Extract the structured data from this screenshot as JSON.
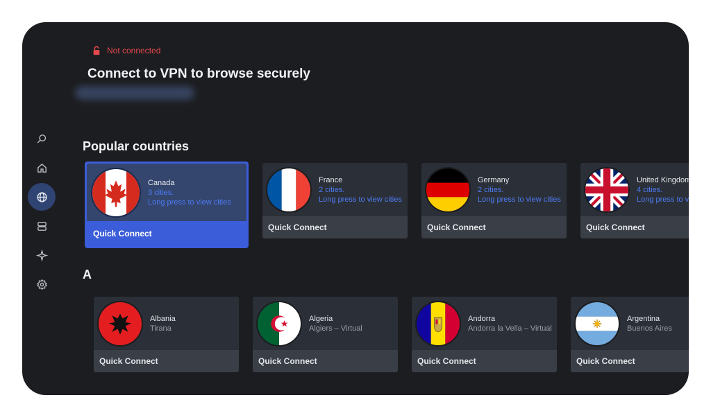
{
  "status": {
    "label": "Not connected",
    "color": "#e5484d"
  },
  "header": {
    "title": "Connect to VPN to browse securely"
  },
  "sidebar": {
    "items": [
      {
        "name": "search",
        "icon": "search-icon"
      },
      {
        "name": "home",
        "icon": "home-icon"
      },
      {
        "name": "countries",
        "icon": "globe-icon",
        "active": true
      },
      {
        "name": "servers",
        "icon": "servers-icon"
      },
      {
        "name": "specialty",
        "icon": "star-icon"
      },
      {
        "name": "settings",
        "icon": "gear-icon"
      }
    ]
  },
  "popular": {
    "title": "Popular countries",
    "countries": [
      {
        "name": "Canada",
        "cities": "3 cities.",
        "hint": "Long press to view cities",
        "action": "Quick Connect",
        "selected": true
      },
      {
        "name": "France",
        "cities": "2 cities.",
        "hint": "Long press to view cities",
        "action": "Quick Connect"
      },
      {
        "name": "Germany",
        "cities": "2 cities.",
        "hint": "Long press to view cities",
        "action": "Quick Connect"
      },
      {
        "name": "United Kingdom",
        "cities": "4 cities.",
        "hint": "Long press to view cities",
        "action": "Quick Connect"
      }
    ]
  },
  "section_a": {
    "letter": "A",
    "countries": [
      {
        "name": "Albania",
        "sub": "Tirana",
        "action": "Quick Connect"
      },
      {
        "name": "Algeria",
        "sub": "Algiers – Virtual",
        "action": "Quick Connect"
      },
      {
        "name": "Andorra",
        "sub": "Andorra la Vella – Virtual",
        "action": "Quick Connect"
      },
      {
        "name": "Argentina",
        "sub": "Buenos Aires",
        "action": "Quick Connect"
      }
    ]
  },
  "colors": {
    "accent": "#3b5dd9",
    "link": "#4d7bf3",
    "background": "#1c1d20",
    "card": "#2b2f37"
  }
}
